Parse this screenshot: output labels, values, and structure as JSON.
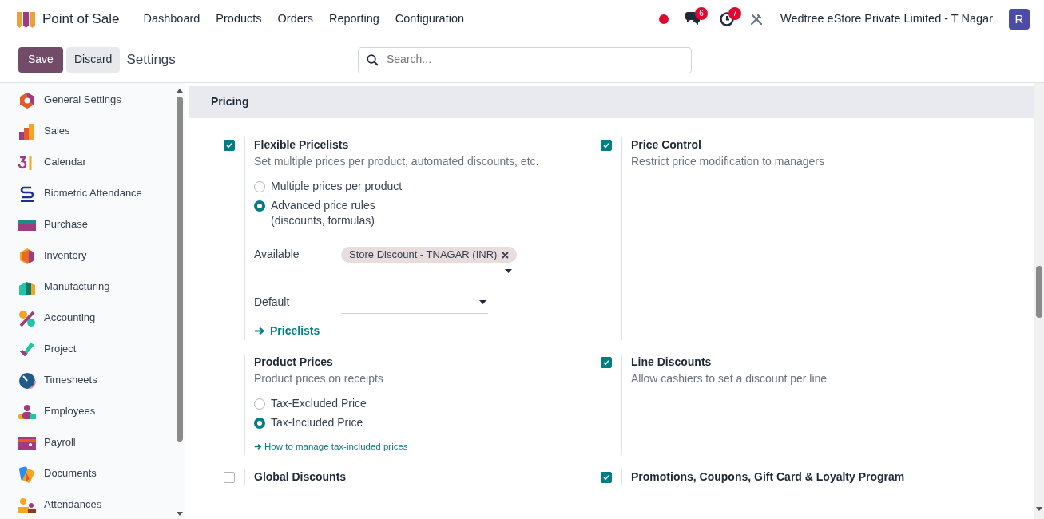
{
  "app": {
    "name": "Point of Sale"
  },
  "menu": [
    "Dashboard",
    "Products",
    "Orders",
    "Reporting",
    "Configuration"
  ],
  "systray": {
    "messages_count": "6",
    "activities_count": "7",
    "company": "Wedtree eStore Private Limited - T Nagar",
    "avatar": "R"
  },
  "control_panel": {
    "buttons": [
      {
        "label": "Save",
        "kind": "primary"
      },
      {
        "label": "Discard",
        "kind": "secondary"
      }
    ],
    "title": "Settings",
    "search": {
      "placeholder": "Search..."
    }
  },
  "sidebar": {
    "items": [
      {
        "label": "General Settings"
      },
      {
        "label": "Sales"
      },
      {
        "label": "Calendar"
      },
      {
        "label": "Biometric Attendance"
      },
      {
        "label": "Purchase"
      },
      {
        "label": "Inventory"
      },
      {
        "label": "Manufacturing"
      },
      {
        "label": "Accounting"
      },
      {
        "label": "Project"
      },
      {
        "label": "Timesheets"
      },
      {
        "label": "Employees"
      },
      {
        "label": "Payroll"
      },
      {
        "label": "Documents"
      },
      {
        "label": "Attendances"
      }
    ]
  },
  "section": {
    "title": "Pricing"
  },
  "settings": [
    {
      "kind": "checkbox",
      "checked": true,
      "title": "Flexible Pricelists",
      "description": "Set multiple prices per product, automated discounts, etc.",
      "options": [
        {
          "label": "Multiple prices per product",
          "selected": false
        },
        {
          "label": "Advanced price rules (discounts, formulas)",
          "selected": true
        }
      ],
      "fields": [
        {
          "label": "Available",
          "tags": [
            "Store Discount - TNAGAR (INR)"
          ]
        },
        {
          "label": "Default"
        }
      ],
      "link": {
        "label": "Pricelists",
        "kind": "button"
      }
    },
    {
      "kind": "checkbox",
      "checked": true,
      "title": "Price Control",
      "description": "Restrict price modification to managers"
    },
    {
      "kind": "plain",
      "title": "Product Prices",
      "description": "Product prices on receipts",
      "options": [
        {
          "label": "Tax-Excluded Price",
          "selected": false
        },
        {
          "label": "Tax-Included Price",
          "selected": true
        }
      ],
      "link": {
        "label": "How to manage tax-included prices",
        "kind": "doc"
      }
    },
    {
      "kind": "checkbox",
      "checked": true,
      "title": "Line Discounts",
      "description": "Allow cashiers to set a discount per line"
    },
    {
      "kind": "checkbox",
      "checked": false,
      "title": "Global Discounts"
    },
    {
      "kind": "checkbox",
      "checked": true,
      "title": "Promotions, Coupons, Gift Card & Loyalty Program"
    }
  ]
}
